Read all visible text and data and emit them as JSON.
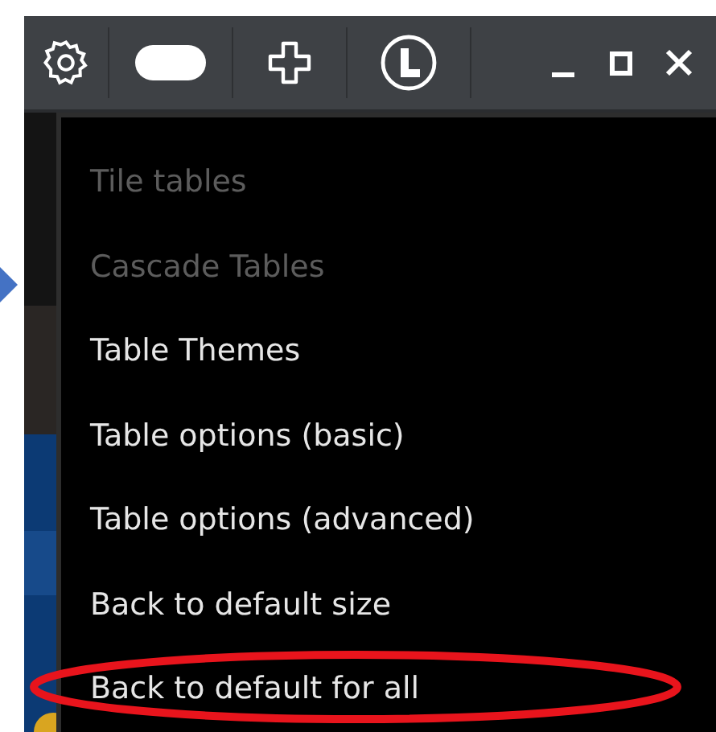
{
  "menu": {
    "items": [
      {
        "label": "Tile tables",
        "disabled": true,
        "circled": false
      },
      {
        "label": "Cascade Tables",
        "disabled": true,
        "circled": false
      },
      {
        "label": "Table Themes",
        "disabled": false,
        "circled": false
      },
      {
        "label": "Table options (basic)",
        "disabled": false,
        "circled": false
      },
      {
        "label": "Table options (advanced)",
        "disabled": false,
        "circled": false
      },
      {
        "label": "Back to default size",
        "disabled": false,
        "circled": false
      },
      {
        "label": "Back to default for all",
        "disabled": false,
        "circled": true
      }
    ]
  }
}
